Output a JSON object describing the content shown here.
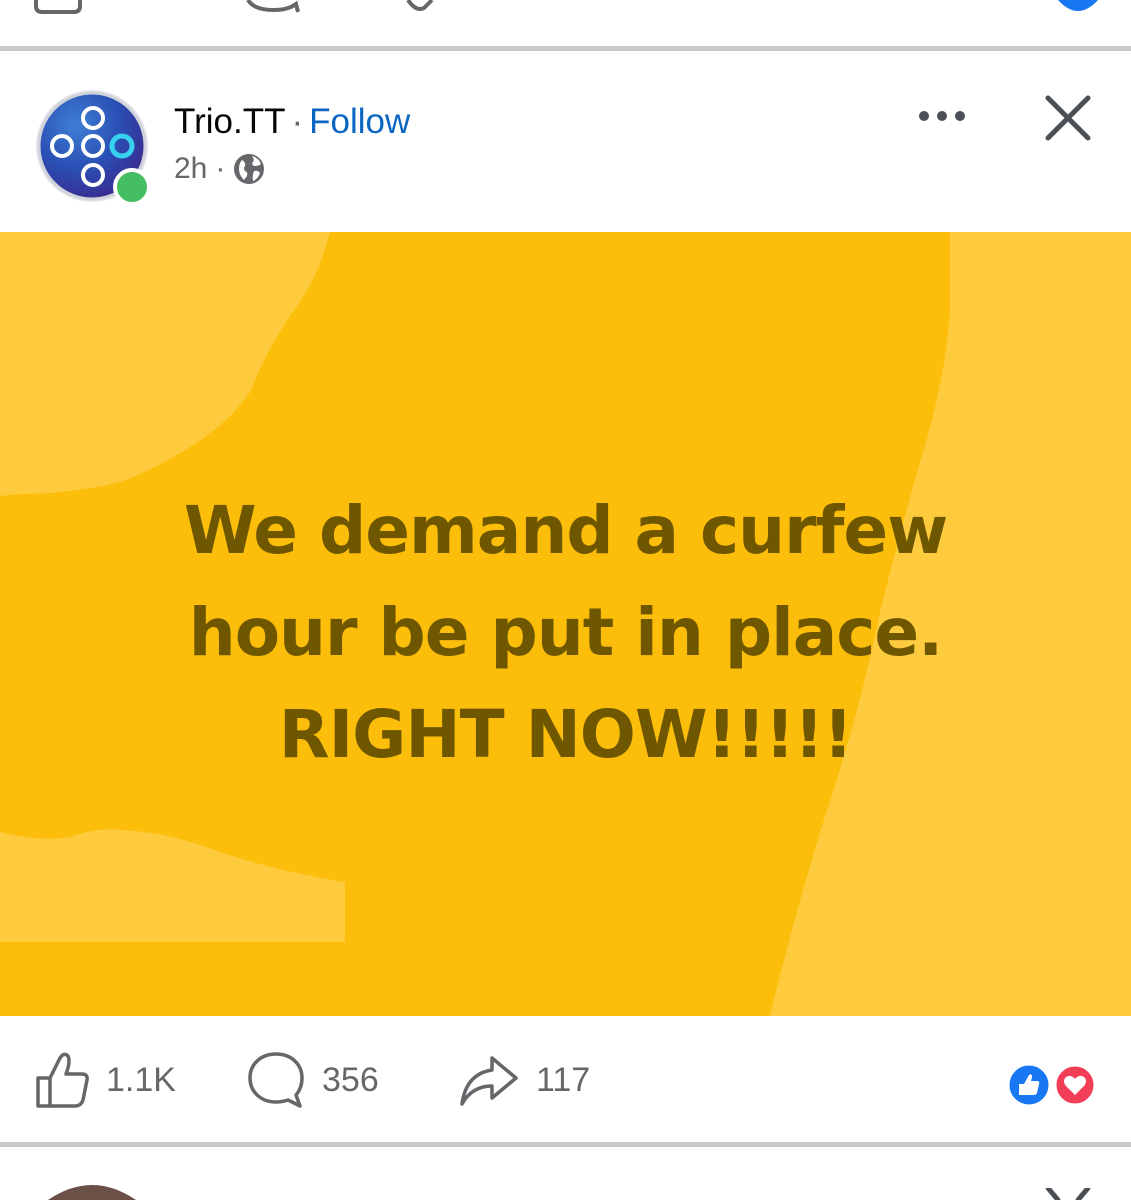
{
  "post": {
    "author": "Trio.TT",
    "separator": "·",
    "follow_label": "Follow",
    "time": "2h",
    "meta_separator": "·",
    "privacy_icon": "globe-icon",
    "text_lines": [
      "We demand a curfew",
      "hour be put in place.",
      "RIGHT NOW!!!!!"
    ],
    "background_color": "#fcbe0b",
    "text_color": "#6f5700"
  },
  "footer": {
    "likes": "1.1K",
    "comments": "356",
    "shares": "117",
    "reaction_icons": [
      "like-reaction-icon",
      "love-reaction-icon"
    ]
  },
  "colors": {
    "accent": "#0a66c2",
    "online": "#45bd62",
    "divider": "#c8c9cc"
  }
}
